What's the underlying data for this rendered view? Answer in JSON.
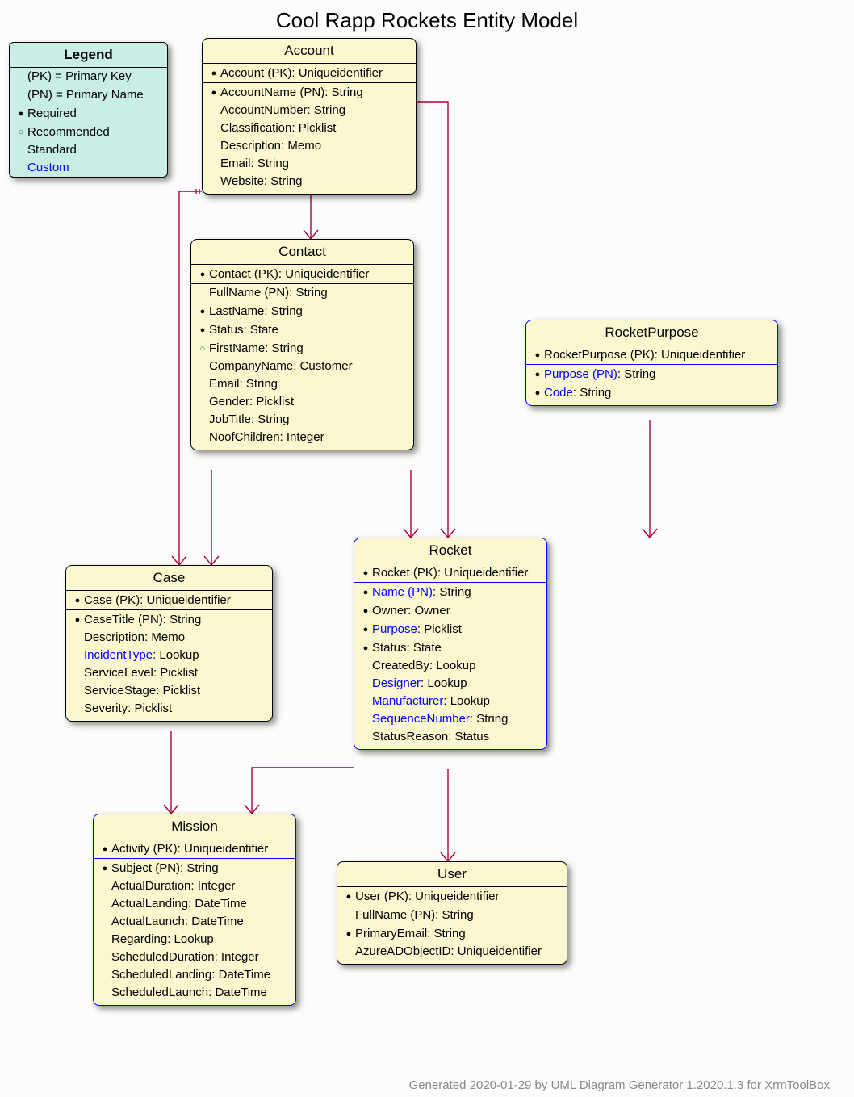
{
  "title": "Cool Rapp Rockets Entity Model",
  "footer": "Generated 2020-01-29 by UML Diagram Generator 1.2020.1.3 for XrmToolBox",
  "legend": {
    "title": "Legend",
    "pk": "(PK) = Primary Key",
    "pn": "(PN) = Primary Name",
    "required": "Required",
    "recommended": "Recommended",
    "standard": "Standard",
    "custom": "Custom"
  },
  "entities": {
    "account": {
      "title": "Account",
      "pk": [
        {
          "b": "req",
          "t": "Account (PK): Uniqueidentifier"
        }
      ],
      "rows": [
        {
          "b": "req",
          "t": "AccountName (PN): String"
        },
        {
          "b": "",
          "t": "AccountNumber: String"
        },
        {
          "b": "",
          "t": "Classification: Picklist"
        },
        {
          "b": "",
          "t": "Description: Memo"
        },
        {
          "b": "",
          "t": "Email: String"
        },
        {
          "b": "",
          "t": "Website: String"
        }
      ]
    },
    "contact": {
      "title": "Contact",
      "pk": [
        {
          "b": "req",
          "t": "Contact (PK): Uniqueidentifier"
        }
      ],
      "rows": [
        {
          "b": "",
          "t": "FullName (PN): String"
        },
        {
          "b": "req",
          "t": "LastName: String"
        },
        {
          "b": "req",
          "t": "Status: State"
        },
        {
          "b": "rec",
          "t": "FirstName: String"
        },
        {
          "b": "",
          "t": "CompanyName: Customer"
        },
        {
          "b": "",
          "t": "Email: String"
        },
        {
          "b": "",
          "t": "Gender: Picklist"
        },
        {
          "b": "",
          "t": "JobTitle: String"
        },
        {
          "b": "",
          "t": "NoofChildren: Integer"
        }
      ]
    },
    "case": {
      "title": "Case",
      "pk": [
        {
          "b": "req",
          "t": "Case (PK): Uniqueidentifier"
        }
      ],
      "rows": [
        {
          "b": "req",
          "t": "CaseTitle (PN): String"
        },
        {
          "b": "",
          "t": "Description: Memo"
        },
        {
          "b": "",
          "t": "IncidentType: Lookup",
          "custom": [
            "IncidentType"
          ]
        },
        {
          "b": "",
          "t": "ServiceLevel: Picklist"
        },
        {
          "b": "",
          "t": "ServiceStage: Picklist"
        },
        {
          "b": "",
          "t": "Severity: Picklist"
        }
      ]
    },
    "rocketpurpose": {
      "title": "RocketPurpose",
      "custom": true,
      "pk": [
        {
          "b": "req",
          "t": "RocketPurpose (PK): Uniqueidentifier"
        }
      ],
      "rows": [
        {
          "b": "req",
          "t": "Purpose (PN): String",
          "custom": [
            "Purpose (PN)"
          ]
        },
        {
          "b": "req",
          "t": "Code: String",
          "custom": [
            "Code"
          ]
        }
      ]
    },
    "rocket": {
      "title": "Rocket",
      "custom": true,
      "pk": [
        {
          "b": "req",
          "t": "Rocket (PK): Uniqueidentifier"
        }
      ],
      "rows": [
        {
          "b": "req",
          "t": "Name (PN): String",
          "custom": [
            "Name (PN)"
          ]
        },
        {
          "b": "req",
          "t": "Owner: Owner"
        },
        {
          "b": "req",
          "t": "Purpose: Picklist",
          "custom": [
            "Purpose"
          ]
        },
        {
          "b": "req",
          "t": "Status: State"
        },
        {
          "b": "",
          "t": "CreatedBy: Lookup"
        },
        {
          "b": "",
          "t": "Designer: Lookup",
          "custom": [
            "Designer"
          ]
        },
        {
          "b": "",
          "t": "Manufacturer: Lookup",
          "custom": [
            "Manufacturer"
          ]
        },
        {
          "b": "",
          "t": "SequenceNumber: String",
          "custom": [
            "SequenceNumber"
          ]
        },
        {
          "b": "",
          "t": "StatusReason: Status"
        }
      ]
    },
    "mission": {
      "title": "Mission",
      "custom": true,
      "pk": [
        {
          "b": "req",
          "t": "Activity (PK): Uniqueidentifier"
        }
      ],
      "rows": [
        {
          "b": "req",
          "t": "Subject (PN): String"
        },
        {
          "b": "",
          "t": "ActualDuration: Integer"
        },
        {
          "b": "",
          "t": "ActualLanding: DateTime"
        },
        {
          "b": "",
          "t": "ActualLaunch: DateTime"
        },
        {
          "b": "",
          "t": "Regarding: Lookup"
        },
        {
          "b": "",
          "t": "ScheduledDuration: Integer"
        },
        {
          "b": "",
          "t": "ScheduledLanding: DateTime"
        },
        {
          "b": "",
          "t": "ScheduledLaunch: DateTime"
        }
      ]
    },
    "user": {
      "title": "User",
      "pk": [
        {
          "b": "req",
          "t": "User (PK): Uniqueidentifier"
        }
      ],
      "rows": [
        {
          "b": "",
          "t": "FullName (PN): String"
        },
        {
          "b": "req",
          "t": "PrimaryEmail: String"
        },
        {
          "b": "",
          "t": "AzureADObjectID: Uniqueidentifier"
        }
      ]
    }
  },
  "chart_data": {
    "type": "table",
    "title": "Cool Rapp Rockets Entity Model",
    "note": "UML class/entity diagram",
    "entities": [
      {
        "name": "Account",
        "custom": false,
        "pk": "Account",
        "attributes": [
          {
            "name": "AccountName",
            "type": "String",
            "required": true,
            "pn": true
          },
          {
            "name": "AccountNumber",
            "type": "String"
          },
          {
            "name": "Classification",
            "type": "Picklist"
          },
          {
            "name": "Description",
            "type": "Memo"
          },
          {
            "name": "Email",
            "type": "String"
          },
          {
            "name": "Website",
            "type": "String"
          }
        ]
      },
      {
        "name": "Contact",
        "custom": false,
        "pk": "Contact",
        "attributes": [
          {
            "name": "FullName",
            "type": "String",
            "pn": true
          },
          {
            "name": "LastName",
            "type": "String",
            "required": true
          },
          {
            "name": "Status",
            "type": "State",
            "required": true
          },
          {
            "name": "FirstName",
            "type": "String",
            "recommended": true
          },
          {
            "name": "CompanyName",
            "type": "Customer"
          },
          {
            "name": "Email",
            "type": "String"
          },
          {
            "name": "Gender",
            "type": "Picklist"
          },
          {
            "name": "JobTitle",
            "type": "String"
          },
          {
            "name": "NoofChildren",
            "type": "Integer"
          }
        ]
      },
      {
        "name": "Case",
        "custom": false,
        "pk": "Case",
        "attributes": [
          {
            "name": "CaseTitle",
            "type": "String",
            "required": true,
            "pn": true
          },
          {
            "name": "Description",
            "type": "Memo"
          },
          {
            "name": "IncidentType",
            "type": "Lookup",
            "custom": true
          },
          {
            "name": "ServiceLevel",
            "type": "Picklist"
          },
          {
            "name": "ServiceStage",
            "type": "Picklist"
          },
          {
            "name": "Severity",
            "type": "Picklist"
          }
        ]
      },
      {
        "name": "RocketPurpose",
        "custom": true,
        "pk": "RocketPurpose",
        "attributes": [
          {
            "name": "Purpose",
            "type": "String",
            "required": true,
            "pn": true,
            "custom": true
          },
          {
            "name": "Code",
            "type": "String",
            "required": true,
            "custom": true
          }
        ]
      },
      {
        "name": "Rocket",
        "custom": true,
        "pk": "Rocket",
        "attributes": [
          {
            "name": "Name",
            "type": "String",
            "required": true,
            "pn": true,
            "custom": true
          },
          {
            "name": "Owner",
            "type": "Owner",
            "required": true
          },
          {
            "name": "Purpose",
            "type": "Picklist",
            "required": true,
            "custom": true
          },
          {
            "name": "Status",
            "type": "State",
            "required": true
          },
          {
            "name": "CreatedBy",
            "type": "Lookup"
          },
          {
            "name": "Designer",
            "type": "Lookup",
            "custom": true
          },
          {
            "name": "Manufacturer",
            "type": "Lookup",
            "custom": true
          },
          {
            "name": "SequenceNumber",
            "type": "String",
            "custom": true
          },
          {
            "name": "StatusReason",
            "type": "Status"
          }
        ]
      },
      {
        "name": "Mission",
        "custom": true,
        "pk": "Activity",
        "attributes": [
          {
            "name": "Subject",
            "type": "String",
            "required": true,
            "pn": true
          },
          {
            "name": "ActualDuration",
            "type": "Integer"
          },
          {
            "name": "ActualLanding",
            "type": "DateTime"
          },
          {
            "name": "ActualLaunch",
            "type": "DateTime"
          },
          {
            "name": "Regarding",
            "type": "Lookup"
          },
          {
            "name": "ScheduledDuration",
            "type": "Integer"
          },
          {
            "name": "ScheduledLanding",
            "type": "DateTime"
          },
          {
            "name": "ScheduledLaunch",
            "type": "DateTime"
          }
        ]
      },
      {
        "name": "User",
        "custom": false,
        "pk": "User",
        "attributes": [
          {
            "name": "FullName",
            "type": "String",
            "pn": true
          },
          {
            "name": "PrimaryEmail",
            "type": "String",
            "required": true
          },
          {
            "name": "AzureADObjectID",
            "type": "Uniqueidentifier"
          }
        ]
      }
    ],
    "relationships": [
      {
        "from": "Account",
        "to": "Contact",
        "type": "one-to-many"
      },
      {
        "from": "Account",
        "to": "Case",
        "type": "one-to-many"
      },
      {
        "from": "Account",
        "to": "Rocket",
        "type": "one-to-many"
      },
      {
        "from": "Contact",
        "to": "Case",
        "type": "one-to-many"
      },
      {
        "from": "Contact",
        "to": "Rocket",
        "type": "one-to-many"
      },
      {
        "from": "RocketPurpose",
        "to": "Rocket",
        "type": "one-to-many"
      },
      {
        "from": "Case",
        "to": "Mission",
        "type": "one-to-many"
      },
      {
        "from": "Rocket",
        "to": "Mission",
        "type": "one-to-many"
      },
      {
        "from": "Rocket",
        "to": "User",
        "type": "one-to-many"
      }
    ]
  }
}
